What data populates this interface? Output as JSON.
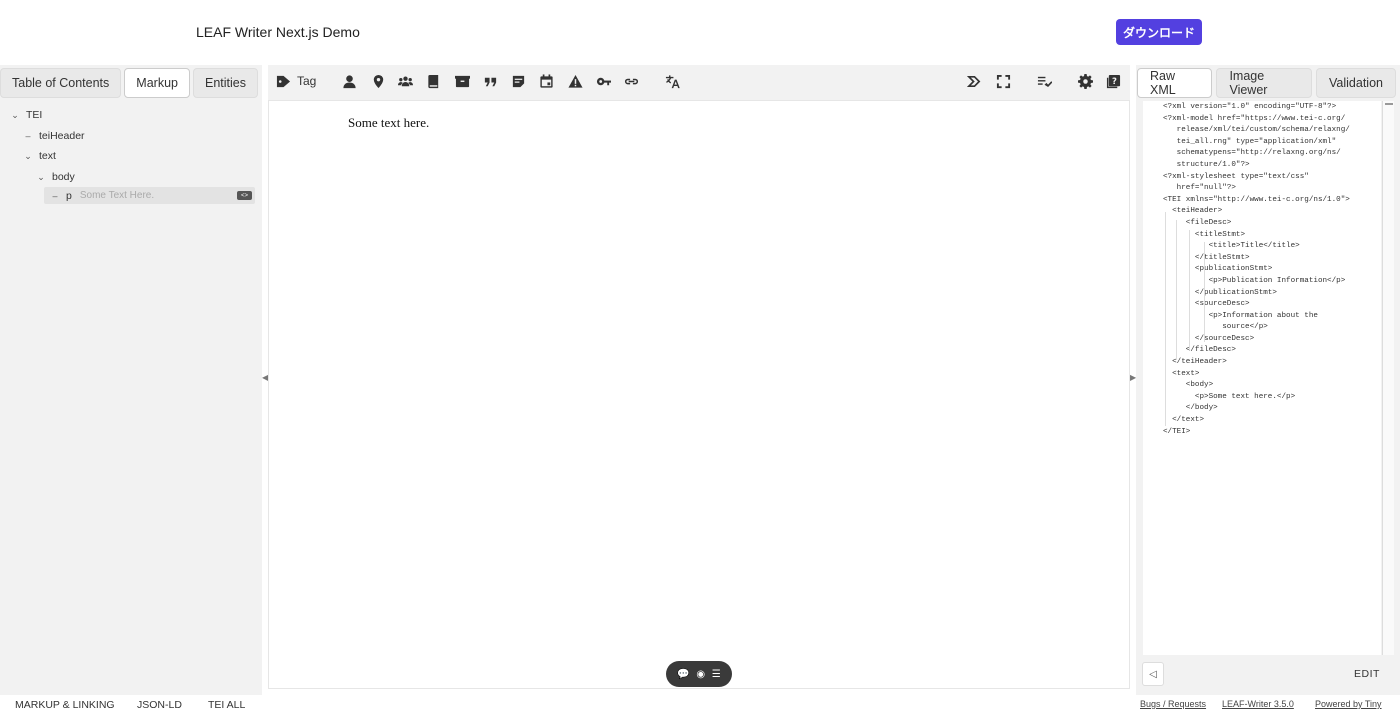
{
  "header": {
    "title": "LEAF Writer Next.js Demo",
    "download_label": "ダウンロード",
    "accent_color": "#5340e0"
  },
  "left_panel": {
    "tabs": [
      "Table of Contents",
      "Markup",
      "Entities"
    ],
    "active_tab": "Markup",
    "tree": [
      {
        "label": "TEI",
        "icon": "chevron-down-icon",
        "depth": 0
      },
      {
        "label": "teiHeader",
        "icon": "dash-icon",
        "depth": 1
      },
      {
        "label": "text",
        "icon": "chevron-down-icon",
        "depth": 1
      },
      {
        "label": "body",
        "icon": "chevron-down-icon",
        "depth": 2
      },
      {
        "label": "p",
        "icon": "dash-icon",
        "depth": 3,
        "preview": "Some Text Here."
      }
    ]
  },
  "toolbar": {
    "tag_label": "Tag",
    "icons": [
      "tag-icon",
      "person-icon",
      "place-icon",
      "organization-icon",
      "book-icon",
      "thing-icon",
      "quote-icon",
      "note-icon",
      "date-icon",
      "warning-icon",
      "key-icon",
      "link-icon",
      "translate-icon",
      "flow-icon",
      "fullscreen-icon",
      "validate-icon",
      "settings-icon",
      "help-icon"
    ]
  },
  "editor": {
    "content": "Some text here."
  },
  "right_panel": {
    "tabs": [
      "Raw XML",
      "Image Viewer",
      "Validation"
    ],
    "active_tab": "Raw XML",
    "xml_lines": [
      "<?xml version=\"1.0\" encoding=\"UTF-8\"?>",
      "<?xml-model href=\"https://www.tei-c.org/",
      "   release/xml/tei/custom/schema/relaxng/",
      "   tei_all.rng\" type=\"application/xml\"",
      "   schematypens=\"http://relaxng.org/ns/",
      "   structure/1.0\"?>",
      "<?xml-stylesheet type=\"text/css\"",
      "   href=\"null\"?>",
      "<TEI xmlns=\"http://www.tei-c.org/ns/1.0\">",
      "  <teiHeader>",
      "     <fileDesc>",
      "       <titleStmt>",
      "          <title>Title</title>",
      "       </titleStmt>",
      "       <publicationStmt>",
      "          <p>Publication Information</p>",
      "       </publicationStmt>",
      "       <sourceDesc>",
      "          <p>Information about the",
      "             source</p>",
      "       </sourceDesc>",
      "     </fileDesc>",
      "  </teiHeader>",
      "  <text>",
      "     <body>",
      "       <p>Some text here.</p>",
      "     </body>",
      "  </text>",
      "</TEI>"
    ],
    "edit_label": "EDIT"
  },
  "footer": {
    "left_items": [
      "MARKUP & LINKING",
      "JSON-LD",
      "TEI ALL"
    ],
    "right_links": [
      "Bugs / Requests",
      "LEAF-Writer 3.5.0",
      "Powered by Tiny"
    ]
  }
}
